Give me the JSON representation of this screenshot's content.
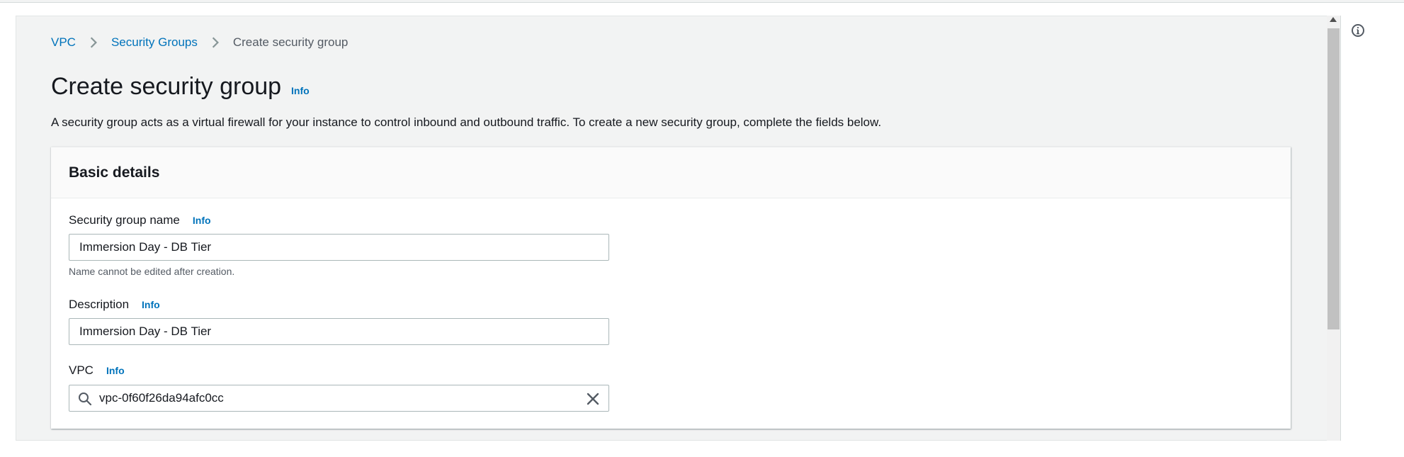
{
  "breadcrumb": {
    "items": [
      {
        "label": "VPC"
      },
      {
        "label": "Security Groups"
      },
      {
        "label": "Create security group"
      }
    ]
  },
  "page": {
    "title": "Create security group",
    "info": "Info",
    "description": "A security group acts as a virtual firewall for your instance to control inbound and outbound traffic. To create a new security group, complete the fields below."
  },
  "basic_details": {
    "title": "Basic details",
    "name_field": {
      "label": "Security group name",
      "info": "Info",
      "value": "Immersion Day - DB Tier",
      "hint": "Name cannot be edited after creation."
    },
    "description_field": {
      "label": "Description",
      "info": "Info",
      "value": "Immersion Day - DB Tier"
    },
    "vpc_field": {
      "label": "VPC",
      "info": "Info",
      "value": "vpc-0f60f26da94afc0cc"
    }
  },
  "colors": {
    "link": "#0073bb",
    "text": "#16191f",
    "muted": "#545b64",
    "background": "#f2f3f3"
  }
}
